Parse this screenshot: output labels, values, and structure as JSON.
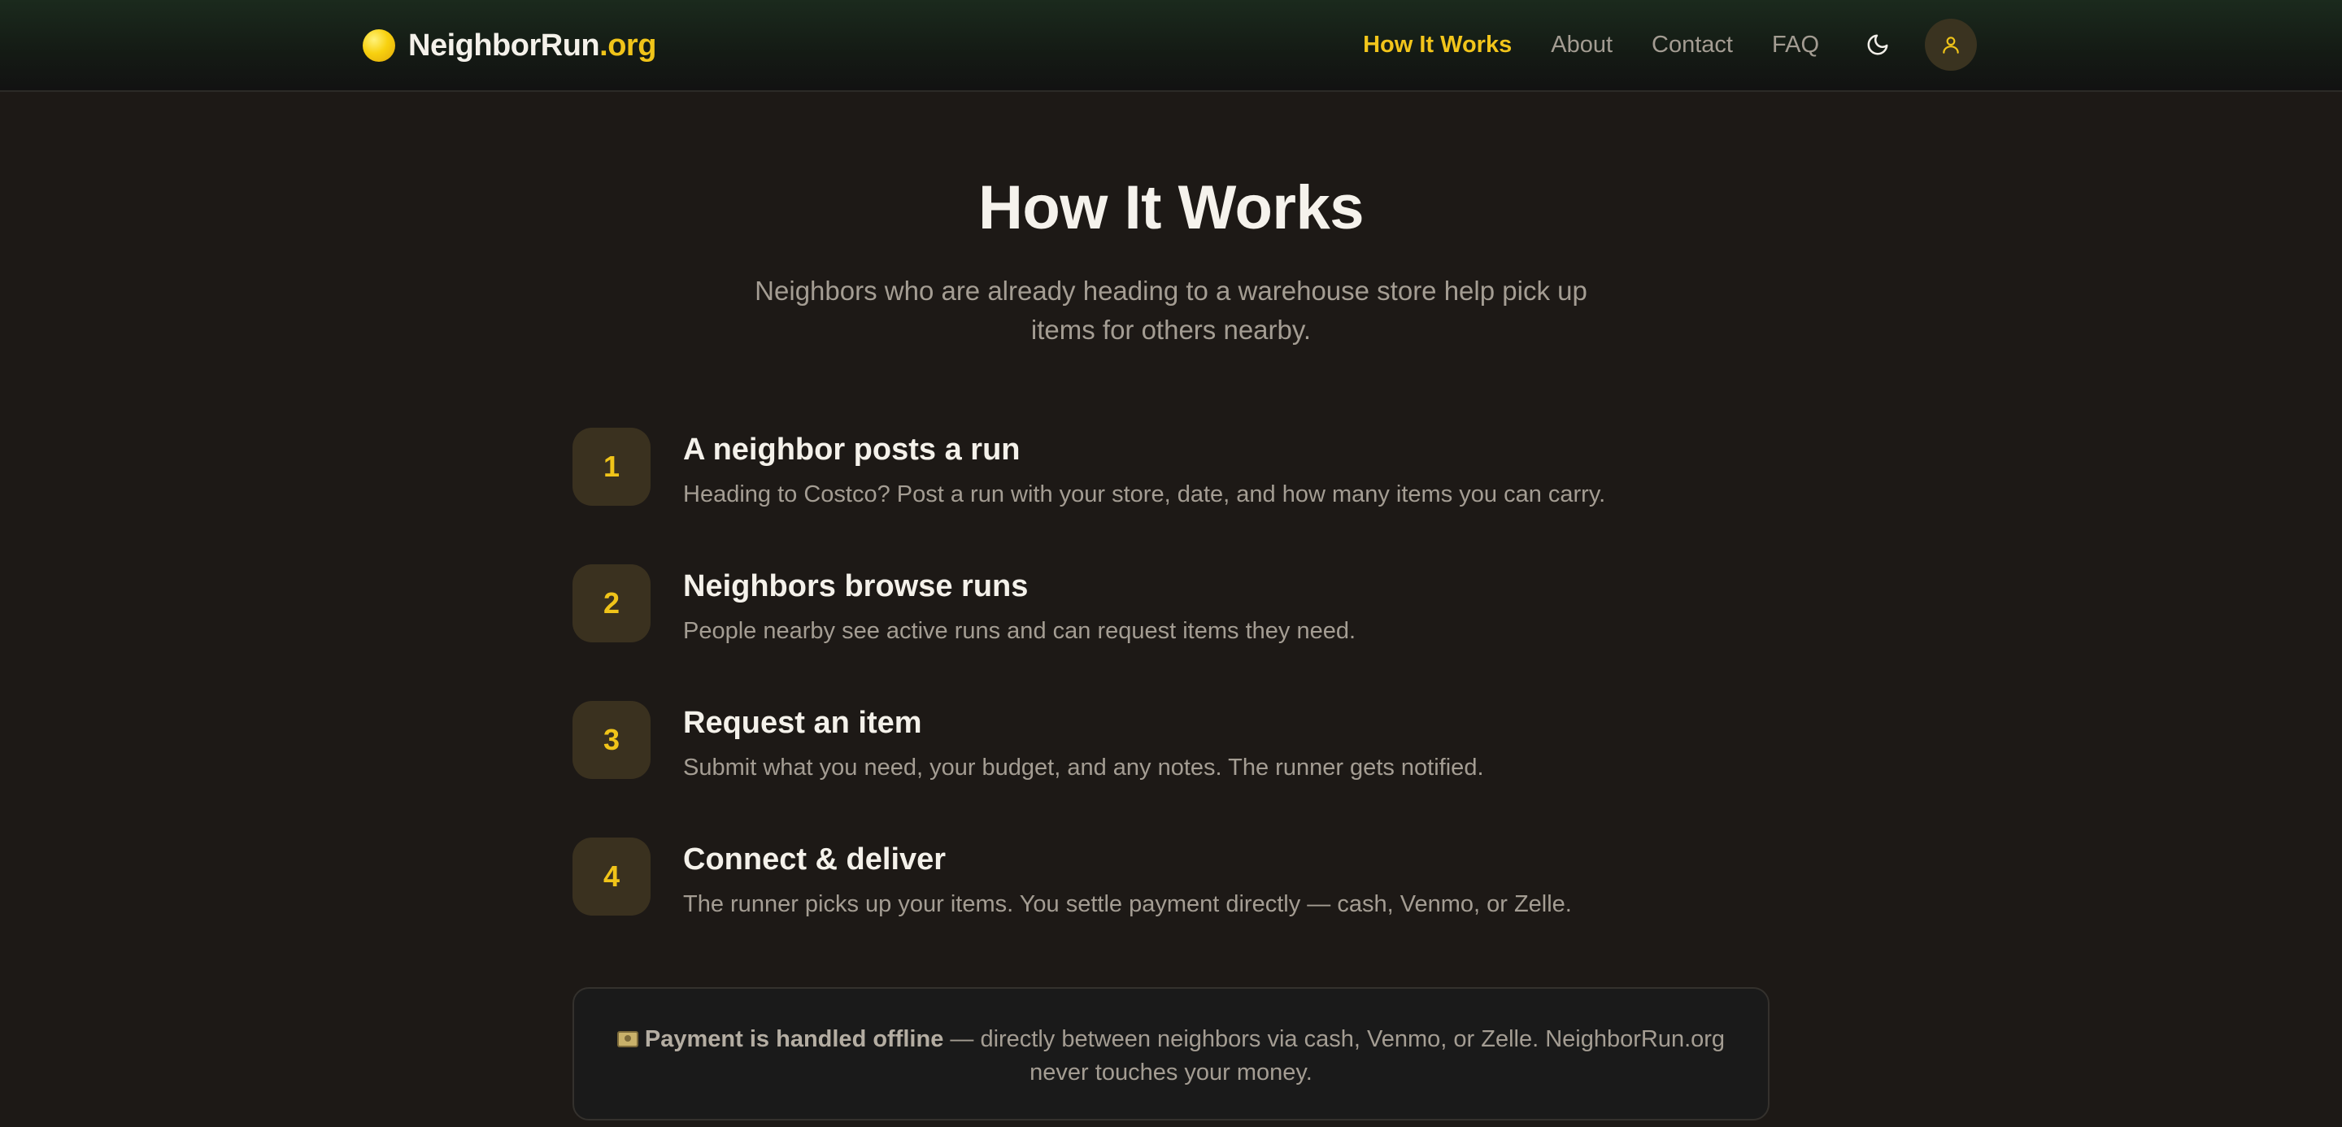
{
  "header": {
    "brand_name": "NeighborRun",
    "brand_tld": ".org",
    "nav": [
      {
        "label": "How It Works",
        "active": true
      },
      {
        "label": "About"
      },
      {
        "label": "Contact"
      },
      {
        "label": "FAQ"
      }
    ],
    "theme_icon": "moon-icon",
    "user_icon": "user-icon"
  },
  "hero": {
    "title": "How It Works",
    "subtitle": "Neighbors who are already heading to a warehouse store help pick up items for others nearby."
  },
  "steps": [
    {
      "number": "1",
      "title": "A neighbor posts a run",
      "description": "Heading to Costco? Post a run with your store, date, and how many items you can carry."
    },
    {
      "number": "2",
      "title": "Neighbors browse runs",
      "description": "People nearby see active runs and can request items they need."
    },
    {
      "number": "3",
      "title": "Request an item",
      "description": "Submit what you need, your budget, and any notes. The runner gets notified."
    },
    {
      "number": "4",
      "title": "Connect & deliver",
      "description": "The runner picks up your items. You settle payment directly — cash, Venmo, or Zelle."
    }
  ],
  "note": {
    "emoji": "money-icon",
    "strong": "Payment is handled offline",
    "text": " — directly between neighbors via cash, Venmo, or Zelle. NeighborRun.org never touches your money."
  },
  "colors": {
    "background": "#1d1916",
    "accent": "#f0c419",
    "muted_text": "#a49d93",
    "step_badge": "#3a311f"
  }
}
